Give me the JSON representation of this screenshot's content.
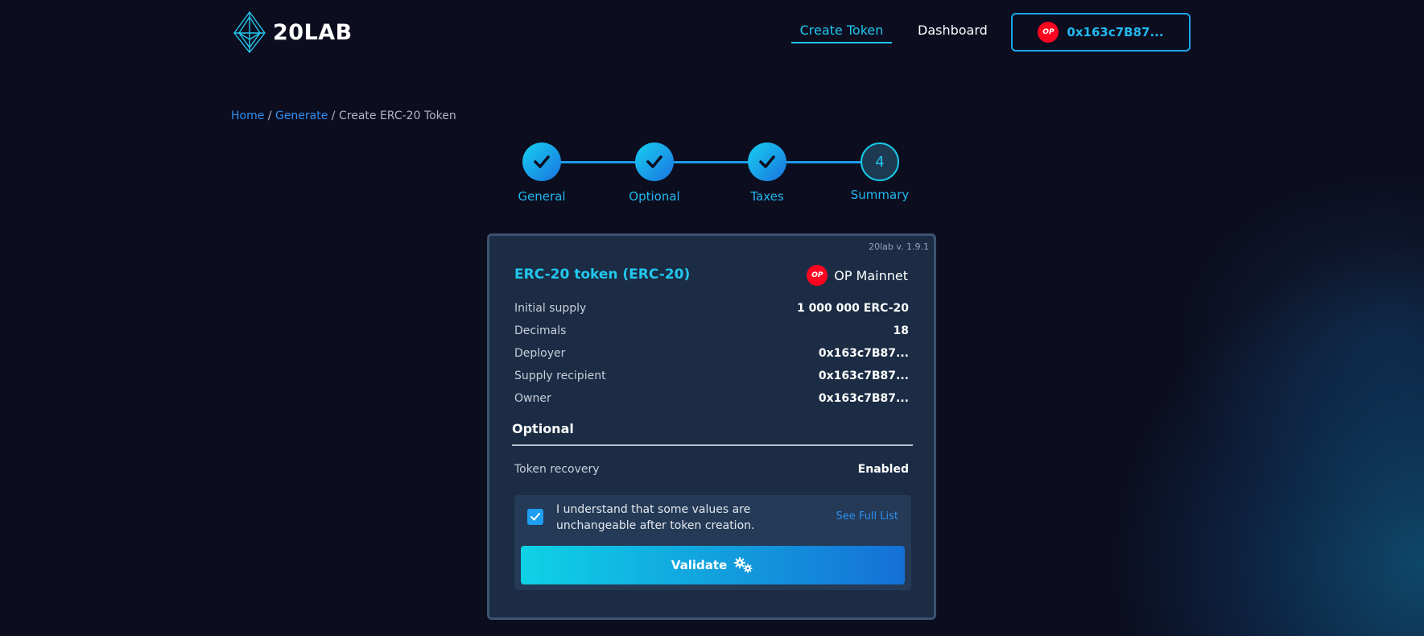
{
  "header": {
    "logo_text": "20LAB",
    "nav": {
      "create_token": "Create Token",
      "dashboard": "Dashboard"
    },
    "wallet": {
      "network_badge": "OP",
      "address": "0x163c7B87..."
    }
  },
  "breadcrumb": {
    "home": "Home",
    "sep1": " / ",
    "generate": "Generate",
    "sep2": " / ",
    "current": "Create ERC-20 Token"
  },
  "stepper": {
    "steps": [
      {
        "label": "General",
        "state": "done"
      },
      {
        "label": "Optional",
        "state": "done"
      },
      {
        "label": "Taxes",
        "state": "done"
      },
      {
        "label": "Summary",
        "state": "current",
        "number": "4"
      }
    ]
  },
  "summary": {
    "version": "20lab v. 1.9.1",
    "title": "ERC-20 token (ERC-20)",
    "network_badge": "OP",
    "network": "OP Mainnet",
    "rows": [
      {
        "label": "Initial supply",
        "value": "1 000 000 ERC-20"
      },
      {
        "label": "Decimals",
        "value": "18"
      },
      {
        "label": "Deployer",
        "value": "0x163c7B87..."
      },
      {
        "label": "Supply recipient",
        "value": "0x163c7B87..."
      },
      {
        "label": "Owner",
        "value": "0x163c7B87..."
      }
    ],
    "optional_title": "Optional",
    "optional_rows": [
      {
        "label": "Token recovery",
        "value": "Enabled"
      }
    ],
    "consent_text": "I understand that some values are unchangeable after token creation.",
    "consent_checked": true,
    "see_full_list": "See Full List",
    "validate_label": "Validate"
  },
  "colors": {
    "background": "#0c0d1f",
    "accent": "#22c7ee",
    "link": "#2f8ff0",
    "card": "#1b2c44",
    "op_red": "#ff0420"
  }
}
